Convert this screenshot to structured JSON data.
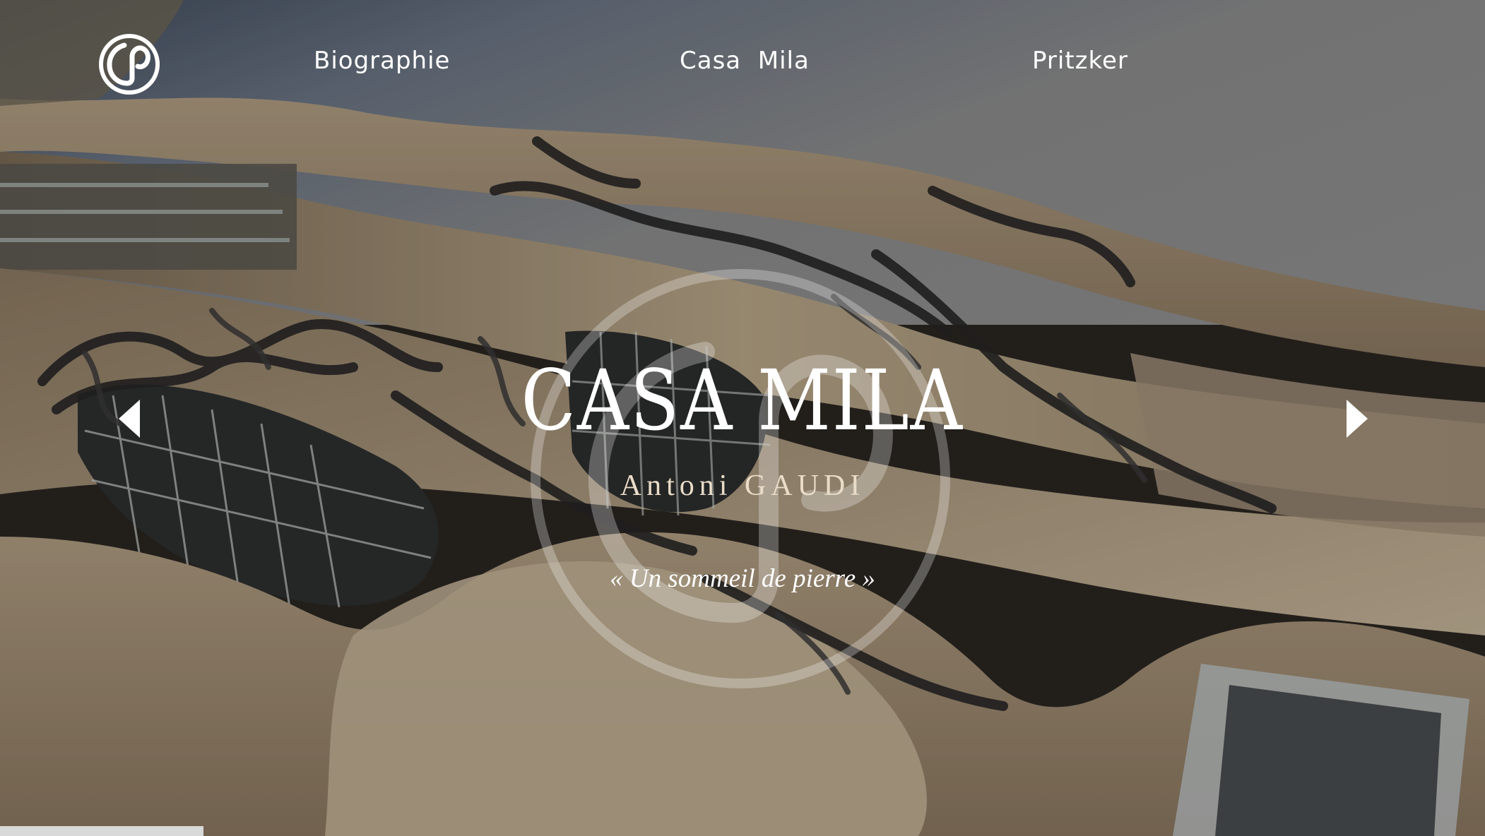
{
  "nav": {
    "logo_icon": "gaudi-monogram-icon",
    "links": [
      {
        "label": "Biographie"
      },
      {
        "label": "Casa  Mila"
      },
      {
        "label": "Pritzker"
      }
    ]
  },
  "hero": {
    "title": "CASA MILA",
    "architect": "Antoni GAUDI",
    "quote": "« Un sommeil de pierre »",
    "background_image": "casa-mila-facade-photo",
    "watermark_icon": "gaudi-monogram-watermark-icon"
  },
  "carousel": {
    "prev_icon": "arrow-left-icon",
    "next_icon": "arrow-right-icon"
  },
  "colors": {
    "text": "#ffffff",
    "subtitle": "#e9dcc8",
    "stone": "#b9a68a",
    "iron": "#2b2a2a"
  }
}
